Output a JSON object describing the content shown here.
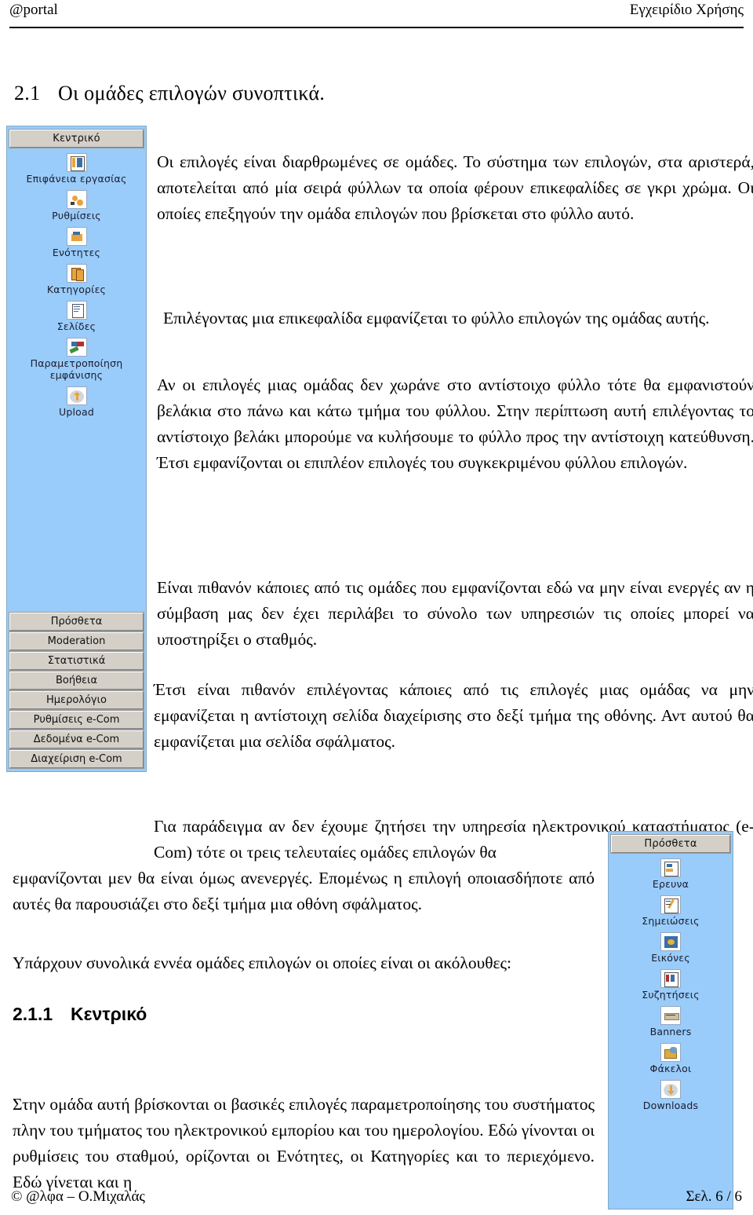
{
  "header": {
    "left": "@portal",
    "right": "Εγχειρίδιο Χρήσης"
  },
  "footer": {
    "left": "© @λφα – Ο.Μιχαλάς",
    "right": "Σελ. 6 / 6"
  },
  "headings": {
    "section_number": "2.1",
    "section_title": "Οι ομάδες επιλογών συνοπτικά.",
    "subsection_number": "2.1.1",
    "subsection_title": "Κεντρικό"
  },
  "paragraphs": {
    "p1": "Οι επιλογές είναι διαρθρωμένες σε ομάδες. Το σύστημα των επιλογών, στα αριστερά, αποτελείται από μία σειρά φύλλων τα οποία φέρουν επικεφαλίδες σε γκρι χρώμα. Οι οποίες επεξηγούν την ομάδα επιλογών που βρίσκεται στο φύλλο αυτό.",
    "p2": "Επιλέγοντας μια επικεφαλίδα εμφανίζεται το φύλλο επιλογών της ομάδας αυτής.",
    "p3": "Αν οι επιλογές μιας ομάδας δεν χωράνε στο αντίστοιχο φύλλο τότε θα εμφανιστούν βελάκια στο πάνω και κάτω τμήμα του φύλλου. Στην περίπτωση αυτή επιλέγοντας το αντίστοιχο βελάκι  μπορούμε να κυλήσουμε το φύλλο προς την αντίστοιχη κατεύθυνση. Έτσι εμφανίζονται οι επιπλέον επιλογές του συγκεκριμένου φύλλου επιλογών.",
    "p4": "Είναι πιθανόν κάποιες από τις ομάδες που εμφανίζονται εδώ να μην είναι ενεργές αν η σύμβαση μας δεν έχει περιλάβει το σύνολο των υπηρεσιών τις οποίες μπορεί να υποστηρίξει ο σταθμός.",
    "p5": "Έτσι είναι πιθανόν επιλέγοντας κάποιες από τις επιλογές μιας ομάδας να μην εμφανίζεται η αντίστοιχη σελίδα διαχείρισης στο δεξί τμήμα της οθόνης. Αντ αυτού θα εμφανίζεται μια σελίδα σφάλματος.",
    "p6": "Για παράδειγμα αν δεν έχουμε ζητήσει την υπηρεσία ηλεκτρονικού καταστήματος (e-Com) τότε οι τρεις τελευταίες ομάδες επιλογών θα",
    "p6_cont": "εμφανίζονται μεν θα είναι όμως ανενεργές. Επομένως η επιλογή οποιασδήποτε από αυτές θα παρουσιάζει στο δεξί τμήμα μια οθόνη σφάλματος.",
    "p7": "Υπάρχουν συνολικά εννέα ομάδες επιλογών οι οποίες είναι οι ακόλουθες:",
    "p8": "Στην ομάδα αυτή βρίσκονται οι βασικές επιλογές παραμετροποίησης του συστήματος πλην του τμήματος του ηλεκτρονικού εμπορίου και του ημερολογίου. Εδώ γίνονται οι ρυθμίσεις του σταθμού, ορίζονται οι Ενότητες, οι Κατηγορίες και το περιεχόμενο. Εδώ γίνεται και η"
  },
  "left_panel": {
    "header_label": "Κεντρικό",
    "items": [
      {
        "label": "Επιφάνεια εργασίας",
        "icon": "desktop-icon"
      },
      {
        "label": "Ρυθμίσεις",
        "icon": "settings-gears-icon"
      },
      {
        "label": "Ενότητες",
        "icon": "sections-icon"
      },
      {
        "label": "Κατηγορίες",
        "icon": "categories-icon"
      },
      {
        "label": "Σελίδες",
        "icon": "pages-icon"
      },
      {
        "label": "Παραμετροποίηση εμφάνισης",
        "icon": "appearance-paint-icon"
      },
      {
        "label": "Upload",
        "icon": "upload-arrow-icon"
      }
    ],
    "buttons": [
      "Πρόσθετα",
      "Moderation",
      "Στατιστικά",
      "Βοήθεια",
      "Ημερολόγιο",
      "Ρυθμίσεις e-Com",
      "Δεδομένα e-Com",
      "Διαχείριση e-Com"
    ]
  },
  "right_panel": {
    "header_label": "Πρόσθετα",
    "items": [
      {
        "label": "Ερευνα",
        "icon": "survey-icon"
      },
      {
        "label": "Σημειώσεις",
        "icon": "notes-pencil-icon"
      },
      {
        "label": "Εικόνες",
        "icon": "images-icon"
      },
      {
        "label": "Συζητήσεις",
        "icon": "discussions-icon"
      },
      {
        "label": "Banners",
        "icon": "banner-icon"
      },
      {
        "label": "Φάκελοι",
        "icon": "folders-icon"
      },
      {
        "label": "Downloads",
        "icon": "download-arrow-icon"
      }
    ]
  },
  "colors": {
    "panel_blue": "#99CCFA",
    "button_gray": "#D4D0C8",
    "panel_border": "#7FA9C4",
    "text": "#000000"
  }
}
